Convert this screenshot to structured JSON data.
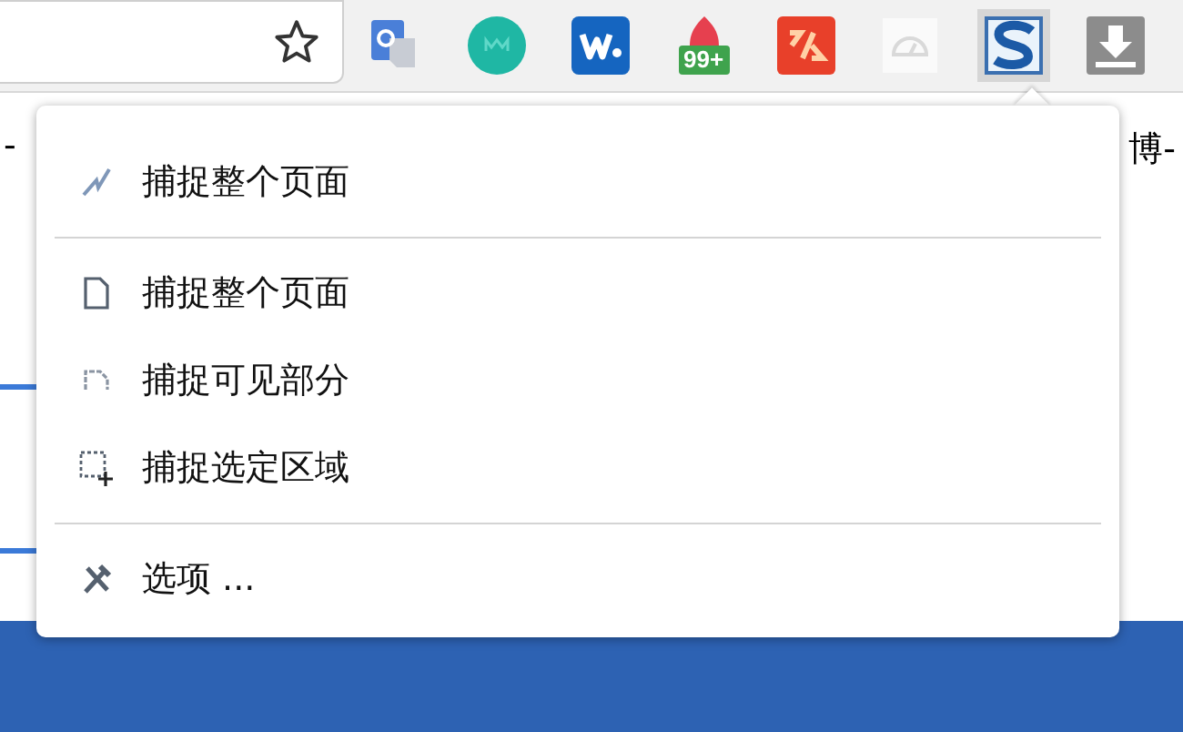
{
  "toolbar": {
    "extensions": [
      {
        "kind": "translate",
        "selected": false
      },
      {
        "kind": "circle",
        "selected": false
      },
      {
        "kind": "w",
        "selected": false
      },
      {
        "kind": "alert",
        "selected": false,
        "badge": "99+"
      },
      {
        "kind": "code",
        "selected": false
      },
      {
        "kind": "gauge",
        "selected": false
      },
      {
        "kind": "s",
        "selected": true
      },
      {
        "kind": "download",
        "selected": false
      }
    ]
  },
  "page": {
    "left_text": "-",
    "right_text": "博-"
  },
  "menu": {
    "sections": [
      {
        "items": [
          {
            "kind": "spark",
            "label": "捕捉整个页面"
          }
        ]
      },
      {
        "items": [
          {
            "kind": "page",
            "label": "捕捉整个页面"
          },
          {
            "kind": "visible",
            "label": "捕捉可见部分"
          },
          {
            "kind": "region",
            "label": "捕捉选定区域"
          }
        ]
      },
      {
        "items": [
          {
            "kind": "tools",
            "label": "选项 ..."
          }
        ]
      }
    ]
  }
}
